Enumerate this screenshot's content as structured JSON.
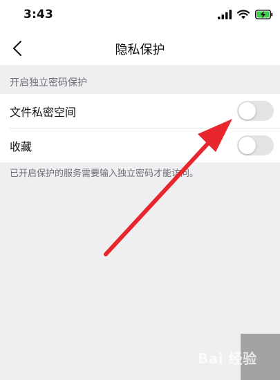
{
  "status_bar": {
    "time": "3:43"
  },
  "nav": {
    "title": "隐私保护"
  },
  "section": {
    "header": "开启独立密码保护",
    "items": [
      {
        "label": "文件私密空间",
        "enabled": false
      },
      {
        "label": "收藏",
        "enabled": false
      }
    ],
    "footer": "已开启保护的服务需要输入独立密码才能访问。"
  },
  "watermark": {
    "text": "Bai 经验"
  },
  "colors": {
    "background": "#efeff1",
    "toggle_off": "#e4e4e6",
    "arrow": "#e8262e",
    "secondary_text": "#6f6f74"
  },
  "icons": [
    "signal-icon",
    "wifi-icon",
    "battery-charging-icon",
    "back-chevron-icon"
  ]
}
